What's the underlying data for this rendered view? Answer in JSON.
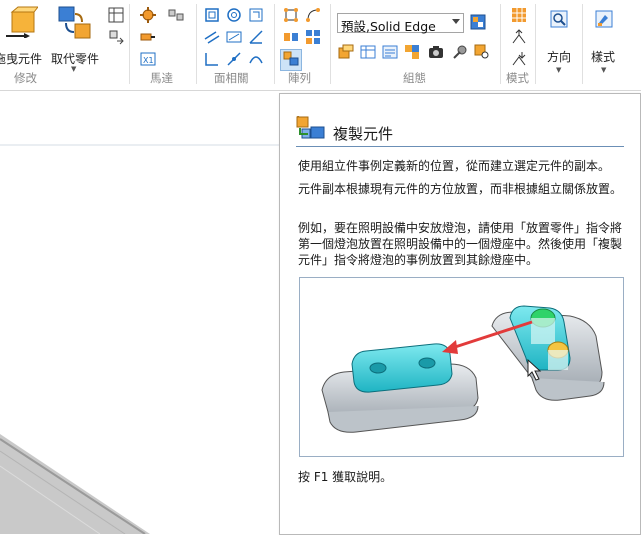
{
  "ribbon": {
    "drag_component_label": "拖曳元件",
    "replace_part_label": "取代零件",
    "group_modify": "修改",
    "group_motor": "馬達",
    "group_face_relate": "面相關",
    "group_pattern": "陣列",
    "group_assemble": "組態",
    "group_mode": "模式",
    "direction_label": "方向",
    "style_label": "樣式",
    "style_combo_value": "預設,Solid Edge"
  },
  "tooltip": {
    "title": "複製元件",
    "para1": "使用組立件事例定義新的位置，從而建立選定元件的副本。",
    "para2": "元件副本根據現有元件的方位放置，而非根據組立關係放置。",
    "para3": "例如，要在照明設備中安放燈泡，請使用「放置零件」指令將第一個燈泡放置在照明設備中的一個燈座中。然後使用「複製元件」指令將燈泡的事例放置到其餘燈座中。",
    "footer": "按 F1 獲取說明。"
  },
  "colors": {
    "accent_blue": "#1f6fc4",
    "cyan_part": "#3ec9d6",
    "arrow_red": "#e23b3b"
  }
}
